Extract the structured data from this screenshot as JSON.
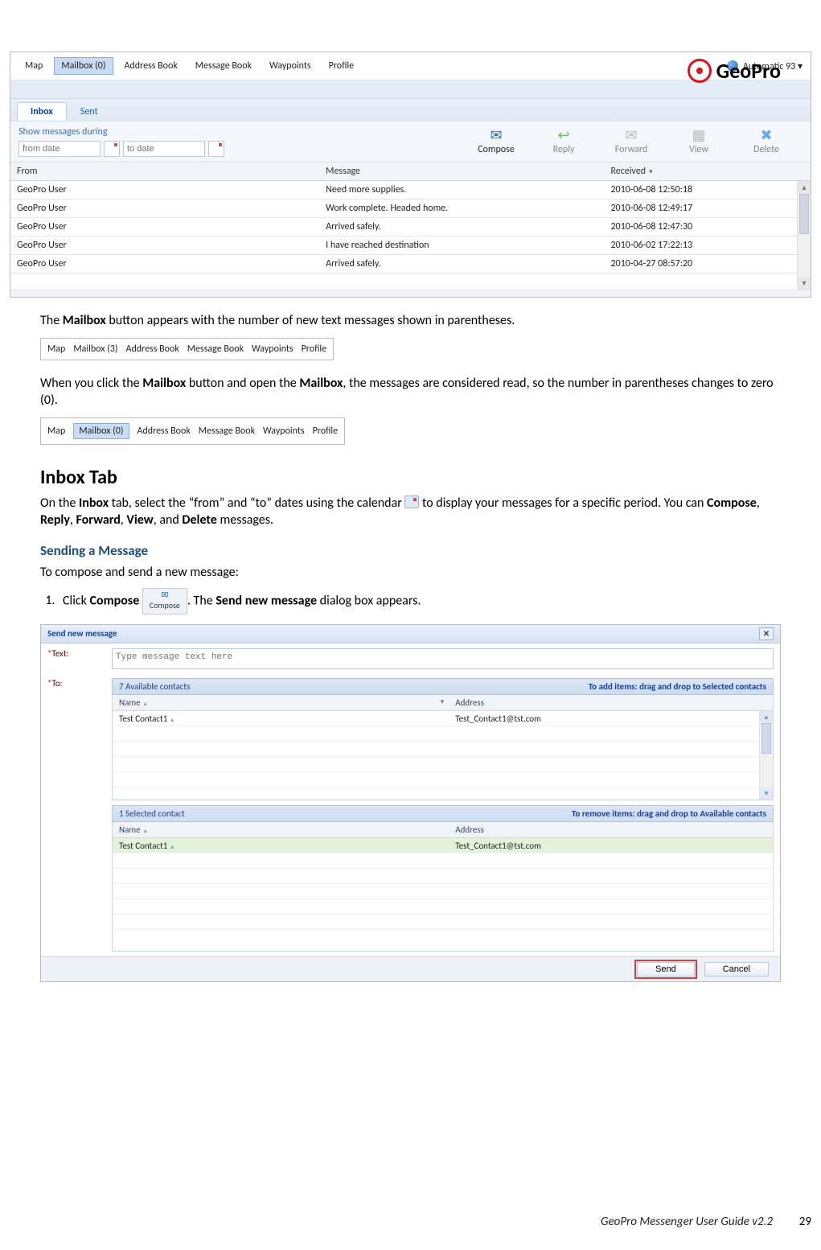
{
  "logo": {
    "brand": "GeoPro"
  },
  "footer": {
    "title": "GeoPro Messenger User Guide v2.2",
    "page": "29"
  },
  "shot1": {
    "nav": [
      "Map",
      "Mailbox (0)",
      "Address Book",
      "Message Book",
      "Waypoints",
      "Profile"
    ],
    "nav_selected": 1,
    "refresh": "Automatic 93",
    "tabs": [
      "Inbox",
      "Sent"
    ],
    "dates_label": "Show messages during",
    "from_ph": "from date",
    "to_ph": "to date",
    "actions": [
      "Compose",
      "Reply",
      "Forward",
      "View",
      "Delete"
    ],
    "cols": [
      "From",
      "Message",
      "Received"
    ],
    "rows": [
      {
        "from": "GeoPro User",
        "msg": "Need more supplies.",
        "rec": "2010-06-08 12:50:18"
      },
      {
        "from": "GeoPro User",
        "msg": "Work complete. Headed home.",
        "rec": "2010-06-08 12:49:17"
      },
      {
        "from": "GeoPro User",
        "msg": "Arrived safely.",
        "rec": "2010-06-08 12:47:30"
      },
      {
        "from": "GeoPro User",
        "msg": "I have reached destination",
        "rec": "2010-06-02 17:22:13"
      },
      {
        "from": "GeoPro User",
        "msg": "Arrived safely.",
        "rec": "2010-04-27 08:57:20"
      }
    ]
  },
  "prose": {
    "p1a": "The ",
    "p1b": "Mailbox",
    "p1c": " button appears with the number of new text messages shown in parentheses.",
    "p2a": "When you click the ",
    "p2b": "Mailbox",
    "p2c": " button and open the ",
    "p2d": "Mailbox",
    "p2e": ", the messages are considered read, so the number in parentheses changes to zero (0).",
    "h2": "Inbox Tab",
    "p3a": "On the ",
    "p3b": "Inbox",
    "p3c": " tab, select the “from” and “to” dates using the calendar ",
    "p3d": " to display your messages for a specific period. You can ",
    "p3e": "Compose",
    "p3f": ", ",
    "p3g": "Reply",
    "p3h": ", ",
    "p3i": "Forward",
    "p3j": ", ",
    "p3k": "View",
    "p3l": ", and ",
    "p3m": "Delete",
    "p3n": " messages.",
    "sh": "Sending a Message",
    "p4": "To compose and send a new message:",
    "li1a": "Click ",
    "li1b": "Compose",
    "li1c": ". The ",
    "li1d": "Send new message",
    "li1e": " dialog box appears.",
    "compose_btn": "Compose"
  },
  "mini1": [
    "Map",
    "Mailbox (3)",
    "Address Book",
    "Message Book",
    "Waypoints",
    "Profile"
  ],
  "mini2": [
    "Map",
    "Mailbox (0)",
    "Address Book",
    "Message Book",
    "Waypoints",
    "Profile"
  ],
  "dlg": {
    "title": "Send new message",
    "text_label": "Text:",
    "text_ph": "Type message text here",
    "to_label": "To:",
    "avail_head": "7 Available contacts",
    "avail_hint": "To add items: drag and drop to Selected contacts",
    "sel_head": "1 Selected contact",
    "sel_hint": "To remove items: drag and drop to Available contacts",
    "col_name": "Name",
    "col_addr": "Address",
    "avail_rows": [
      {
        "name": "Test Contact1",
        "addr": "Test_Contact1@tst.com"
      }
    ],
    "sel_rows": [
      {
        "name": "Test Contact1",
        "addr": "Test_Contact1@tst.com"
      }
    ],
    "send": "Send",
    "cancel": "Cancel"
  }
}
